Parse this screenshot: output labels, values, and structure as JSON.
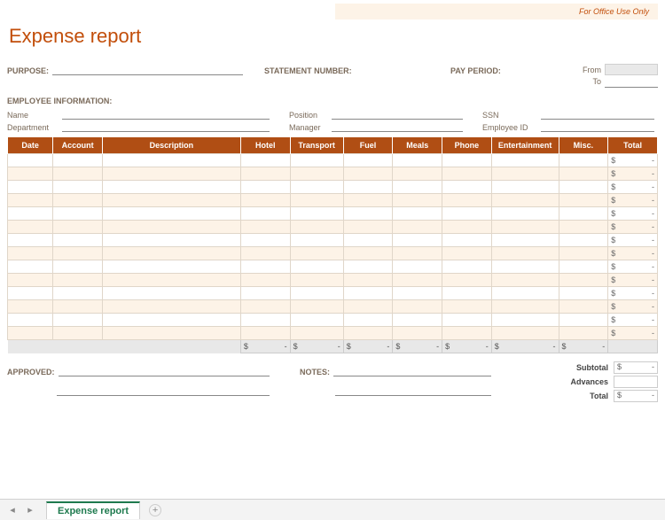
{
  "office_use": "For Office Use Only",
  "title": "Expense report",
  "labels": {
    "purpose": "PURPOSE:",
    "statement_number": "STATEMENT NUMBER:",
    "pay_period": "PAY PERIOD:",
    "from": "From",
    "to": "To",
    "employee_info": "EMPLOYEE INFORMATION:",
    "name": "Name",
    "position": "Position",
    "ssn": "SSN",
    "department": "Department",
    "manager": "Manager",
    "employee_id": "Employee ID",
    "approved": "APPROVED:",
    "notes": "NOTES:",
    "subtotal": "Subtotal",
    "advances": "Advances",
    "total": "Total"
  },
  "columns": [
    "Date",
    "Account",
    "Description",
    "Hotel",
    "Transport",
    "Fuel",
    "Meals",
    "Phone",
    "Entertainment",
    "Misc.",
    "Total"
  ],
  "row_count": 14,
  "row_total": {
    "currency": "$",
    "value": "-"
  },
  "column_sums": [
    {
      "currency": "$",
      "value": "-"
    },
    {
      "currency": "$",
      "value": "-"
    },
    {
      "currency": "$",
      "value": "-"
    },
    {
      "currency": "$",
      "value": "-"
    },
    {
      "currency": "$",
      "value": "-"
    },
    {
      "currency": "$",
      "value": "-"
    },
    {
      "currency": "$",
      "value": "-"
    }
  ],
  "summary": {
    "subtotal": {
      "currency": "$",
      "value": "-"
    },
    "advances": {
      "currency": "",
      "value": ""
    },
    "total": {
      "currency": "$",
      "value": "-"
    }
  },
  "tab_name": "Expense report"
}
